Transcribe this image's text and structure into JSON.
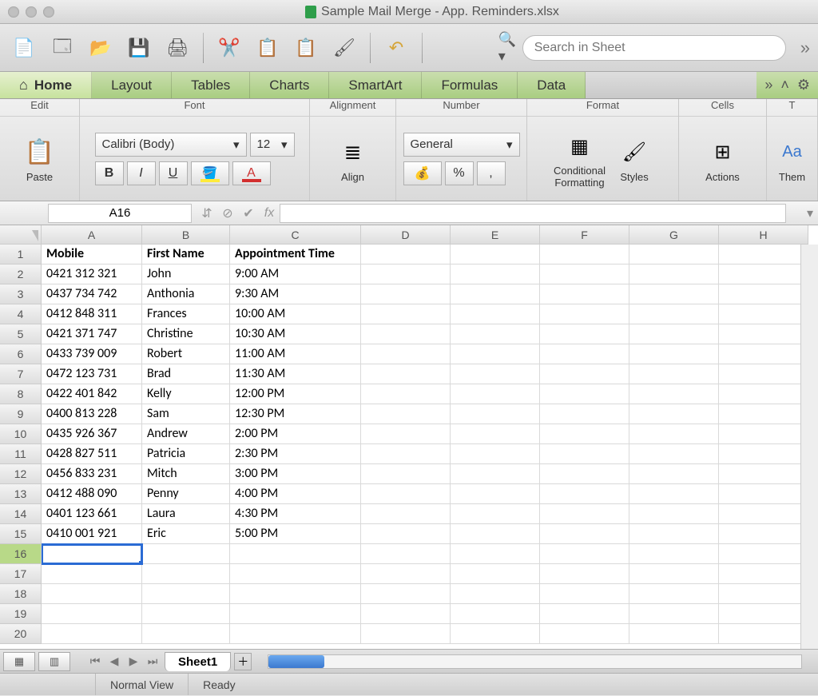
{
  "window": {
    "title": "Sample Mail Merge - App. Reminders.xlsx"
  },
  "search": {
    "placeholder": "Search in Sheet"
  },
  "tabs": [
    "Home",
    "Layout",
    "Tables",
    "Charts",
    "SmartArt",
    "Formulas",
    "Data"
  ],
  "ribbon": {
    "edit_title": "Edit",
    "paste": "Paste",
    "font_title": "Font",
    "font_name": "Calibri (Body)",
    "font_size": "12",
    "alignment_title": "Alignment",
    "align": "Align",
    "number_title": "Number",
    "number_format": "General",
    "format_title": "Format",
    "conditional": "Conditional\nFormatting",
    "styles": "Styles",
    "cells_title": "Cells",
    "actions": "Actions",
    "themes_title": "T",
    "themes": "Them"
  },
  "formula": {
    "namebox": "A16",
    "fx": "fx"
  },
  "columns": [
    {
      "letter": "A",
      "width": 126
    },
    {
      "letter": "B",
      "width": 110
    },
    {
      "letter": "C",
      "width": 164
    },
    {
      "letter": "D",
      "width": 112
    },
    {
      "letter": "E",
      "width": 112
    },
    {
      "letter": "F",
      "width": 112
    },
    {
      "letter": "G",
      "width": 112
    },
    {
      "letter": "H",
      "width": 112
    }
  ],
  "headers": [
    "Mobile",
    "First Name",
    "Appointment Time"
  ],
  "rows": [
    [
      "0421 312 321",
      "John",
      "9:00 AM"
    ],
    [
      "0437 734 742",
      "Anthonia",
      "9:30 AM"
    ],
    [
      "0412 848 311",
      "Frances",
      "10:00 AM"
    ],
    [
      "0421 371 747",
      "Christine",
      "10:30 AM"
    ],
    [
      "0433 739 009",
      "Robert",
      "11:00 AM"
    ],
    [
      "0472 123 731",
      "Brad",
      "11:30 AM"
    ],
    [
      "0422 401 842",
      "Kelly",
      "12:00 PM"
    ],
    [
      "0400 813 228",
      "Sam",
      "12:30 PM"
    ],
    [
      "0435 926 367",
      "Andrew",
      "2:00 PM"
    ],
    [
      "0428 827 511",
      "Patricia",
      "2:30 PM"
    ],
    [
      "0456 833 231",
      "Mitch",
      "3:00 PM"
    ],
    [
      "0412 488 090",
      "Penny",
      "4:00 PM"
    ],
    [
      "0401 123 661",
      "Laura",
      "4:30 PM"
    ],
    [
      "0410 001 921",
      "Eric",
      "5:00 PM"
    ]
  ],
  "row_count": 20,
  "selected_row": 16,
  "sheet": {
    "name": "Sheet1"
  },
  "status": {
    "view": "Normal View",
    "ready": "Ready"
  }
}
